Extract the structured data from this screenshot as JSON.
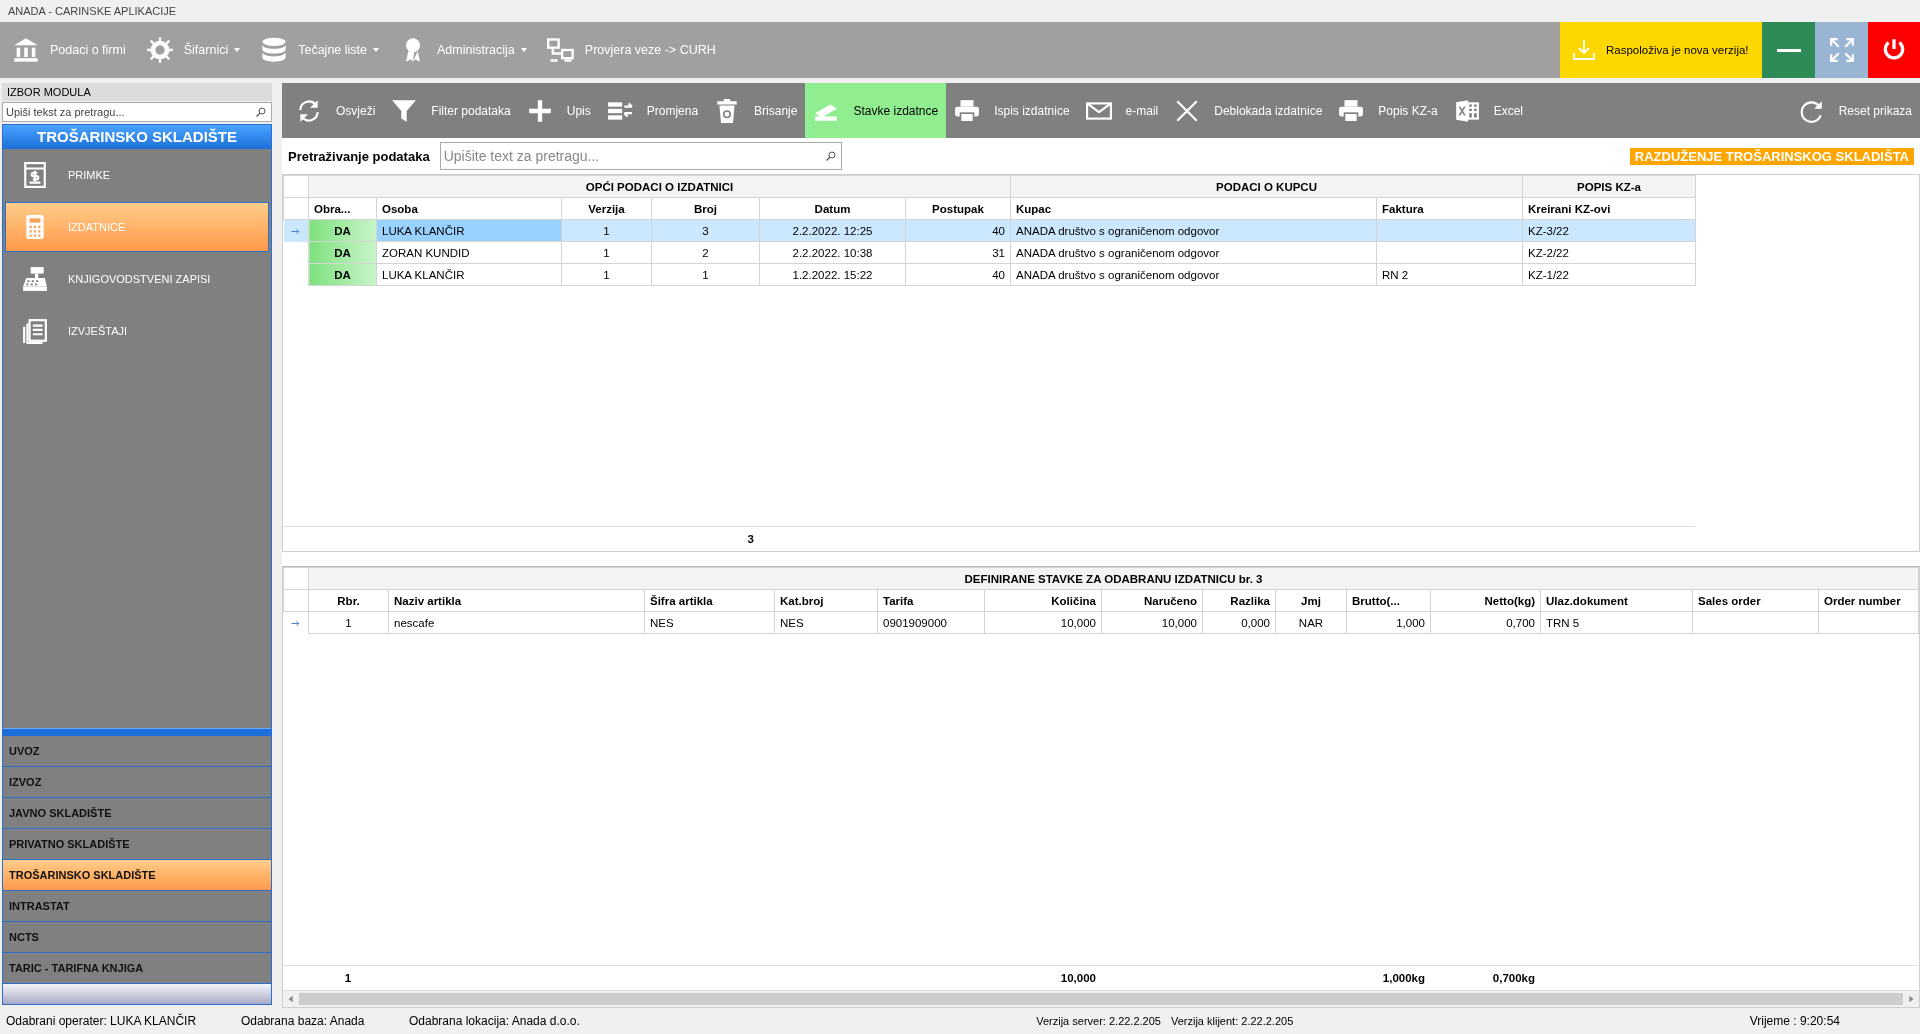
{
  "window": {
    "title": "ANADA - CARINSKE APLIKACIJE"
  },
  "menu_bar": {
    "items": [
      {
        "label": "Podaci o firmi",
        "dropdown": false
      },
      {
        "label": "Šifarnici",
        "dropdown": true
      },
      {
        "label": "Tečajne liste",
        "dropdown": true
      },
      {
        "label": "Administracija",
        "dropdown": true
      },
      {
        "label": "Provjera veze -> CURH",
        "dropdown": false
      }
    ],
    "update_notice": "Raspoloživa je nova verzija!"
  },
  "sidebar": {
    "header": "IZBOR MODULA",
    "search": {
      "placeholder": "Upiši tekst za pretragu..."
    },
    "section_title": "TROŠARINSKO SKLADIŠTE",
    "items": [
      {
        "label": "PRIMKE",
        "selected": false
      },
      {
        "label": "IZDATNICE",
        "selected": true
      },
      {
        "label": "KNJIGOVODSTVENI ZAPISI",
        "selected": false
      },
      {
        "label": "IZVJEŠTAJI",
        "selected": false
      }
    ],
    "modules": [
      {
        "label": "UVOZ",
        "selected": false
      },
      {
        "label": "IZVOZ",
        "selected": false
      },
      {
        "label": "JAVNO SKLADIŠTE",
        "selected": false
      },
      {
        "label": "PRIVATNO SKLADIŠTE",
        "selected": false
      },
      {
        "label": "TROŠARINSKO SKLADIŠTE",
        "selected": true
      },
      {
        "label": "INTRASTAT",
        "selected": false
      },
      {
        "label": "NCTS",
        "selected": false
      },
      {
        "label": "TARIC - TARIFNA KNJIGA",
        "selected": false
      }
    ]
  },
  "toolbar": {
    "items": [
      {
        "label": "Osvježi",
        "selected": false
      },
      {
        "label": "Filter podataka",
        "selected": false
      },
      {
        "label": "Upis",
        "selected": false
      },
      {
        "label": "Promjena",
        "selected": false
      },
      {
        "label": "Brisanje",
        "selected": false
      },
      {
        "label": "Stavke izdatnce",
        "selected": true
      },
      {
        "label": "Ispis izdatnice",
        "selected": false
      },
      {
        "label": "e-mail",
        "selected": false
      },
      {
        "label": "Deblokada izdatnice",
        "selected": false
      },
      {
        "label": "Popis KZ-a",
        "selected": false
      },
      {
        "label": "Excel",
        "selected": false
      }
    ],
    "reset_button": "Reset prikaza"
  },
  "search_row": {
    "label": "Pretraživanje podataka",
    "placeholder": "Upišite text za pretragu...",
    "badge": "RAZDUŽENJE TROŠARINSKOG SKLADIŠTA"
  },
  "upper_grid": {
    "groups": [
      {
        "label": "OPĆI PODACI O IZDATNICI",
        "columns": [
          "Obra...",
          "Osoba",
          "Verzija",
          "Broj",
          "Datum",
          "Postupak"
        ]
      },
      {
        "label": "PODACI O KUPCU",
        "columns": [
          "Kupac",
          "Faktura"
        ]
      },
      {
        "label": "POPIS KZ-a",
        "columns": [
          "Kreirani KZ-ovi"
        ]
      }
    ],
    "rows": [
      {
        "selected": true,
        "obra": "DA",
        "osoba": "LUKA KLANČIR",
        "verzija": "1",
        "broj": "3",
        "datum": "2.2.2022. 12:25",
        "postupak": "40",
        "kupac": "ANADA društvo s ograničenom odgovor",
        "kreirani": "KZ-3/22"
      },
      {
        "selected": false,
        "obra": "DA",
        "osoba": "ZORAN KUNDID",
        "verzija": "1",
        "broj": "2",
        "datum": "2.2.2022. 10:38",
        "postupak": "31",
        "kupac": "ANADA društvo s ograničenom odgovor",
        "kreirani": "KZ-2/22"
      },
      {
        "selected": false,
        "obra": "DA",
        "osoba": "LUKA KLANČIR",
        "verzija": "1",
        "broj": "1",
        "datum": "1.2.2022. 15:22",
        "postupak": "40",
        "kupac": "ANADA društvo s ograničenom odgovor",
        "faktura": "RN 2",
        "kreirani": "KZ-1/22"
      }
    ],
    "footer": {
      "broj": "3"
    }
  },
  "lower_grid": {
    "title": "DEFINIRANE STAVKE ZA ODABRANU IZDATNICU br. 3",
    "columns": [
      "Rbr.",
      "Naziv artikla",
      "Šifra artikla",
      "Kat.broj",
      "Tarifa",
      "Količina",
      "Naručeno",
      "Razlika",
      "Jmj",
      "Brutto(...",
      "Netto(kg)",
      "Ulaz.dokument",
      "Sales order",
      "Order number"
    ],
    "rows": [
      {
        "current": true,
        "rbr": "1",
        "naziv": "nescafe",
        "sifra": "NES",
        "kat": "NES",
        "tarifa": "0901909000",
        "kolicina": "10,000",
        "naruceno": "10,000",
        "razlika": "0,000",
        "jmj": "NAR",
        "brutto": "1,000",
        "netto": "0,700",
        "ulaz": "TRN 5"
      }
    ],
    "footer": {
      "rbr": "1",
      "kolicina": "10,000",
      "brutto": "1,000kg",
      "netto": "0,700kg"
    }
  },
  "status_bar": {
    "operator": "Odabrani operater: LUKA KLANČIR",
    "database": "Odabrana baza: Anada",
    "location": "Odabrana lokacija: Anada d.o.o.",
    "server_version": "Verzija server: 2.22.2.205",
    "client_version": "Verzija klijent: 2.22.2.205",
    "time": "Vrijeme : 9:20:54"
  }
}
